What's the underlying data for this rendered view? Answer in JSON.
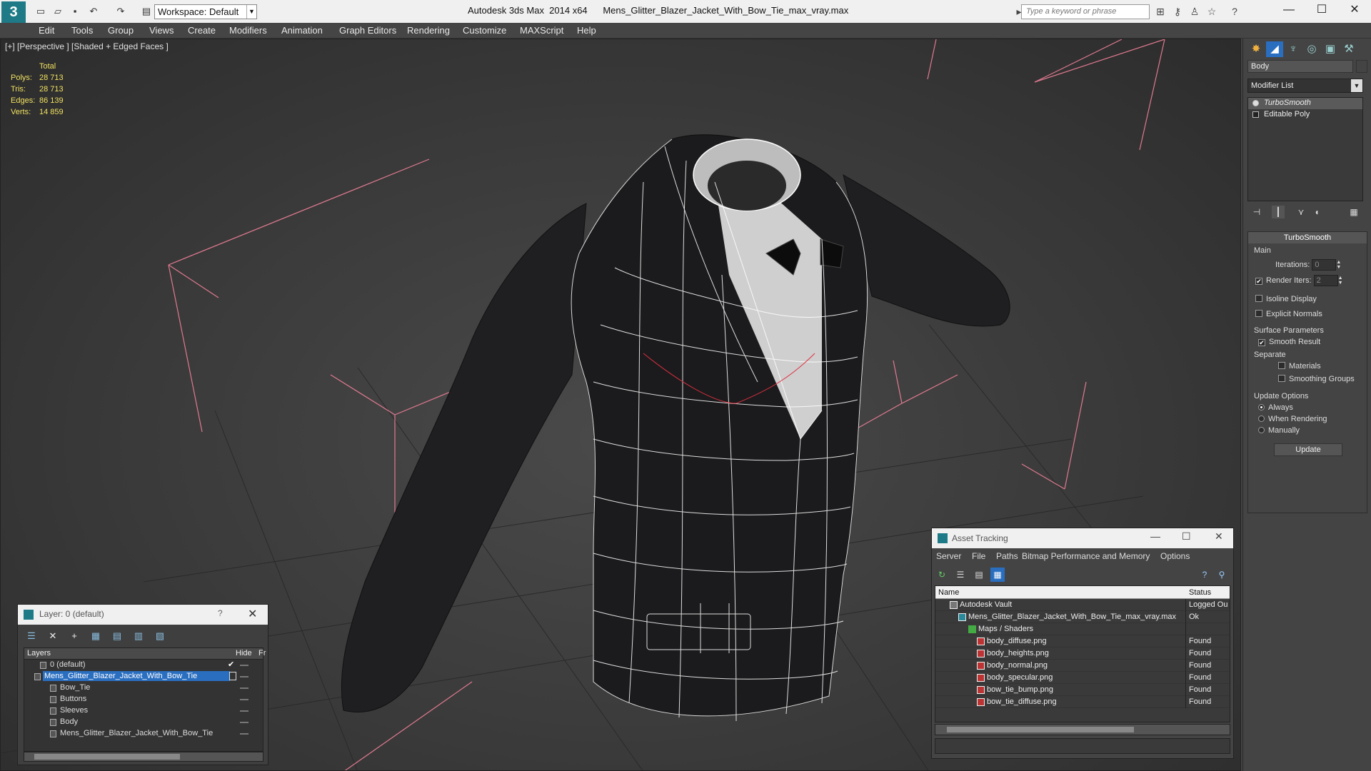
{
  "app": {
    "title": "Autodesk 3ds Max  2014 x64      Mens_Glitter_Blazer_Jacket_With_Bow_Tie_max_vray.max",
    "workspace": "Workspace: Default",
    "search_placeholder": "Type a keyword or phrase"
  },
  "menu": [
    "Edit",
    "Tools",
    "Group",
    "Views",
    "Create",
    "Modifiers",
    "Animation",
    "Graph Editors",
    "Rendering",
    "Customize",
    "MAXScript",
    "Help"
  ],
  "viewport": {
    "label": "[+] [Perspective ] [Shaded + Edged Faces ]",
    "stats": {
      "header": "Total",
      "rows": [
        {
          "label": "Polys:",
          "value": "28 713"
        },
        {
          "label": "Tris:",
          "value": "28 713"
        },
        {
          "label": "Edges:",
          "value": "86 139"
        },
        {
          "label": "Verts:",
          "value": "14 859"
        }
      ]
    }
  },
  "command_panel": {
    "object_name": "Body",
    "modifier_list": "Modifier List",
    "stack": [
      "TurboSmooth",
      "Editable Poly"
    ],
    "rollout_title": "TurboSmooth",
    "main_label": "Main",
    "iterations_label": "Iterations:",
    "iterations_value": "0",
    "render_iters_label": "Render Iters:",
    "render_iters_value": "2",
    "isoline": "Isoline Display",
    "explicit_normals": "Explicit Normals",
    "surface_params": "Surface Parameters",
    "smooth_result": "Smooth Result",
    "separate": "Separate",
    "materials": "Materials",
    "smoothing_groups": "Smoothing Groups",
    "update_options": "Update Options",
    "always": "Always",
    "when_rendering": "When Rendering",
    "manually": "Manually",
    "update_btn": "Update"
  },
  "layer_panel": {
    "title": "Layer: 0 (default)",
    "help": "?",
    "col_layers": "Layers",
    "col_hide": "Hide",
    "col_fr": "Fr",
    "rows": [
      {
        "name": "0 (default)",
        "indent": 1,
        "selected": false
      },
      {
        "name": "Mens_Glitter_Blazer_Jacket_With_Bow_Tie",
        "indent": 0,
        "selected": true
      },
      {
        "name": "Bow_Tie",
        "indent": 2,
        "selected": false
      },
      {
        "name": "Buttons",
        "indent": 2,
        "selected": false
      },
      {
        "name": "Sleeves",
        "indent": 2,
        "selected": false
      },
      {
        "name": "Body",
        "indent": 2,
        "selected": false
      },
      {
        "name": "Mens_Glitter_Blazer_Jacket_With_Bow_Tie",
        "indent": 2,
        "selected": false
      }
    ]
  },
  "asset_tracking": {
    "title": "Asset Tracking",
    "menu": [
      "Server",
      "File",
      "Paths",
      "Bitmap Performance and Memory",
      "Options"
    ],
    "col_name": "Name",
    "col_status": "Status",
    "rows": [
      {
        "name": "Autodesk Vault",
        "status": "Logged Ou",
        "indent": 1
      },
      {
        "name": "Mens_Glitter_Blazer_Jacket_With_Bow_Tie_max_vray.max",
        "status": "Ok",
        "indent": 2
      },
      {
        "name": "Maps / Shaders",
        "status": "",
        "indent": 3
      },
      {
        "name": "body_diffuse.png",
        "status": "Found",
        "indent": 4
      },
      {
        "name": "body_heights.png",
        "status": "Found",
        "indent": 4
      },
      {
        "name": "body_normal.png",
        "status": "Found",
        "indent": 4
      },
      {
        "name": "body_specular.png",
        "status": "Found",
        "indent": 4
      },
      {
        "name": "bow_tie_bump.png",
        "status": "Found",
        "indent": 4
      },
      {
        "name": "bow_tie_diffuse.png",
        "status": "Found",
        "indent": 4
      }
    ]
  }
}
